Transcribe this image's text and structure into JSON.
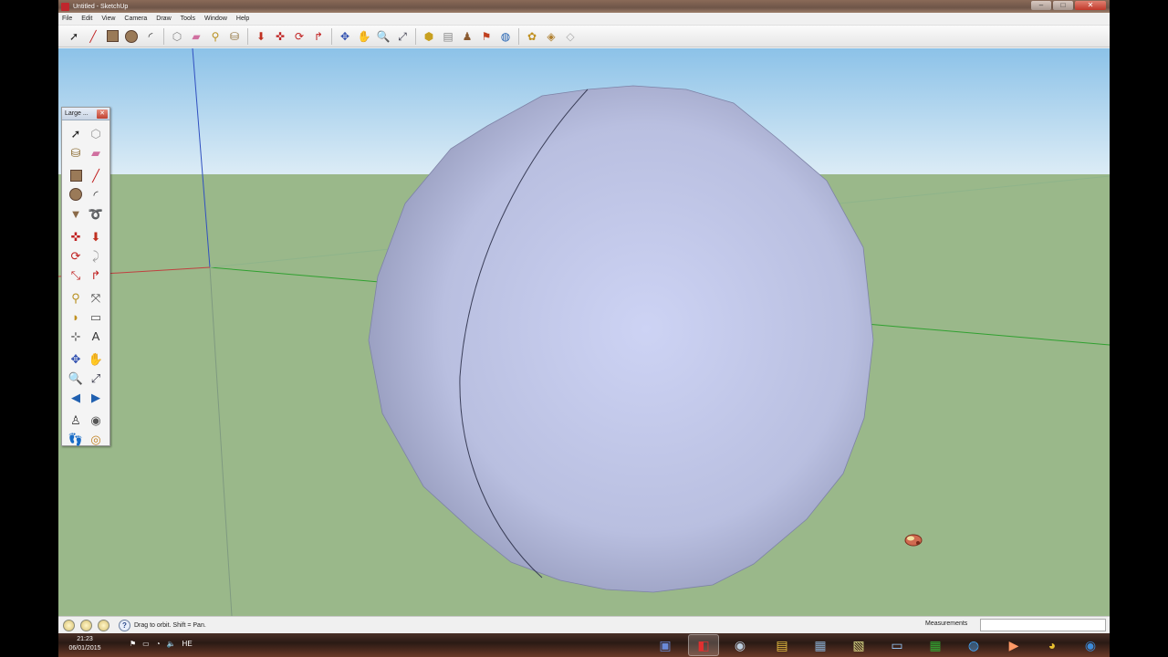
{
  "window": {
    "title": "Untitled - SketchUp",
    "controls": {
      "minimize": "–",
      "maximize": "□",
      "close": "✕"
    }
  },
  "menu": [
    "File",
    "Edit",
    "View",
    "Camera",
    "Draw",
    "Tools",
    "Window",
    "Help"
  ],
  "toolbar": {
    "icons": [
      "select-icon",
      "pencil-line-icon",
      "rectangle-icon",
      "circle-icon",
      "arc-icon",
      "make-component-icon",
      "eraser-icon",
      "tape-measure-icon",
      "paint-bucket-icon",
      "push-pull-icon",
      "move-icon",
      "rotate-icon",
      "follow-me-icon",
      "orbit-icon",
      "pan-icon",
      "zoom-icon",
      "zoom-extents-icon",
      "get-models-icon",
      "share-model-icon",
      "components-icon",
      "extension-warehouse-icon",
      "geo-location-icon",
      "photo-textures-icon",
      "styles-icon"
    ]
  },
  "palette": {
    "title": "Large ...",
    "icons": [
      "select-icon",
      "make-component-icon",
      "paint-bucket-icon",
      "eraser-icon",
      "rectangle-icon",
      "line-icon",
      "circle-icon",
      "arc-icon",
      "polygon-icon",
      "freehand-icon",
      "move-icon",
      "push-pull-icon",
      "rotate-icon",
      "follow-me-icon",
      "scale-icon",
      "offset-icon",
      "tape-measure-icon",
      "dimension-icon",
      "protractor-icon",
      "text-icon",
      "axes-icon",
      "3d-text-icon",
      "orbit-icon",
      "pan-icon",
      "zoom-icon",
      "zoom-window-icon",
      "previous-view-icon",
      "next-view-icon",
      "position-camera-icon",
      "look-around-icon",
      "walk-icon",
      "section-plane-icon"
    ]
  },
  "status": {
    "hint": "Drag to orbit.  Shift = Pan.",
    "measurements_label": "Measurements",
    "measurements_value": ""
  },
  "taskbar": {
    "time": "21:23",
    "date": "06/01/2015",
    "tray": [
      "⚑",
      "▭",
      "◔",
      "🔈",
      "HE"
    ],
    "apps": [
      "save-icon",
      "sketchup-icon",
      "steam-icon",
      "notes-icon",
      "photo-viewer-icon",
      "paint-icon",
      "monitor-icon",
      "excel-icon",
      "explorer-icon",
      "media-player-icon",
      "files-icon",
      "chrome-icon",
      "firefox-icon"
    ]
  },
  "colors": {
    "sky_top": "#8cc2e8",
    "sky_bottom": "#dcecf6",
    "ground": "#9ab88a",
    "sphere": "#c8cdea",
    "axis_red": "#c04040",
    "axis_green": "#30a030",
    "axis_blue": "#3050c0"
  }
}
